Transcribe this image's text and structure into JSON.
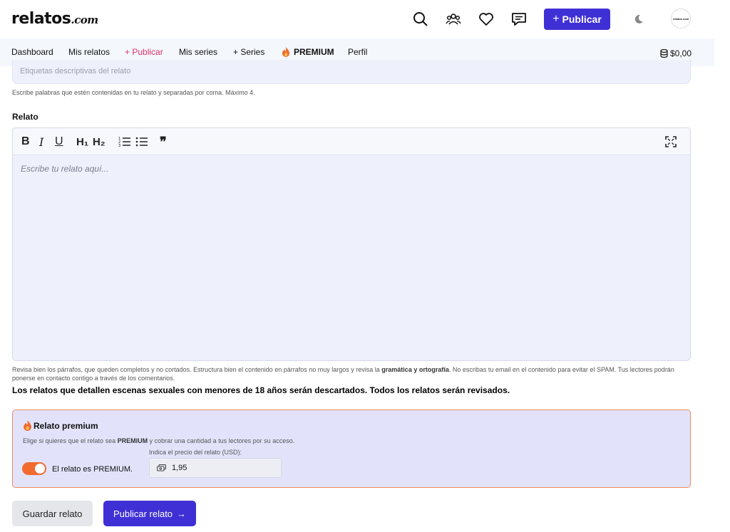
{
  "header": {
    "logo_main": "relatos",
    "logo_tld": ".com",
    "publish_button": "Publicar",
    "avatar_text": "relatos.com"
  },
  "nav": {
    "items": [
      "Dashboard",
      "Mis relatos",
      "+ Publicar",
      "Mis series",
      "+ Series",
      "PREMIUM",
      "Perfil"
    ],
    "balance": "$0,00"
  },
  "form": {
    "tags_placeholder": "Etiquetas descriptivas del relato",
    "tags_help": "Escribe palabras que estén contenidas en tu relato y separadas por coma. Máximo 4.",
    "story_label": "Relato",
    "story_placeholder": "Escribe tu relato aquí...",
    "toolbar": {
      "bold": "B",
      "italic": "I",
      "underline": "U",
      "h1": "H₁",
      "h2": "H₂",
      "quote": "❞"
    },
    "help_part1": "Revisa bien los párrafos, que queden completos y no cortados. Estructura bien el contenido en párrafos no muy largos y revisa la ",
    "help_bold": "gramática y ortografía",
    "help_part2": ". No escribas tu email en el contenido para evitar el SPAM. Tus lectores podrán ponerse en contacto contigo a través de los comentarios.",
    "warning": "Los relatos que detallen escenas sexuales con menores de 18 años serán descartados. Todos los relatos serán revisados."
  },
  "premium": {
    "title": "Relato premium",
    "desc_part1": "Elige si quieres que el relato sea ",
    "desc_bold": "PREMIUM",
    "desc_part2": " y cobrar una cantidad a tus lectores por su acceso.",
    "toggle_label": "El relato es PREMIUM.",
    "toggle_on": true,
    "price_label": "Indica el precio del relato (USD):",
    "price_value": "1,95"
  },
  "actions": {
    "save": "Guardar relato",
    "submit": "Publicar relato"
  },
  "colors": {
    "accent": "#3f30d6",
    "premium_orange": "#f26a2e",
    "nav_pink": "#e0336a"
  }
}
